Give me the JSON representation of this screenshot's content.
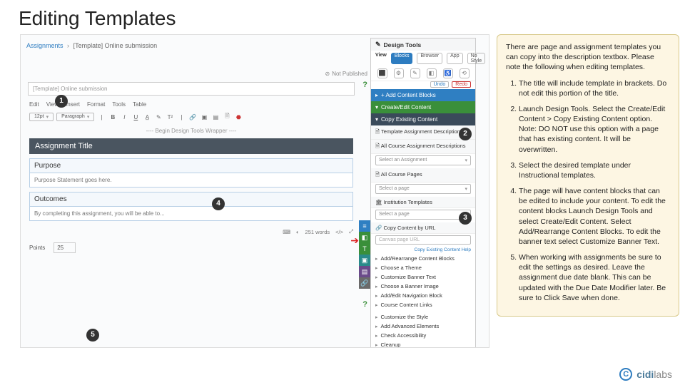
{
  "page_title": "Editing Templates",
  "breadcrumb": {
    "root": "Assignments",
    "current": "[Template] Online submission"
  },
  "not_published": "Not Published",
  "design_tools": {
    "header": "Design Tools",
    "view_label": "View",
    "view_opts": [
      "Blocks",
      "Browser",
      "App",
      "No Style"
    ],
    "add_blocks": "+ Add Content Blocks",
    "undo": "Undo",
    "redo": "Redo",
    "create_edit": "Create/Edit Content",
    "copy_existing": "Copy Existing Content",
    "template_desc": "Template Assignment Descriptions",
    "all_course_desc": "All Course Assignment Descriptions",
    "select_assignment": "Select an Assignment",
    "all_course_pages": "All Course Pages",
    "select_page": "Select a page",
    "institution_templates": "Institution Templates",
    "select_page2": "Select a page",
    "copy_by_url": "Copy Content by URL",
    "url_placeholder": "Canvas page URL",
    "help_link": "Copy Existing Content Help",
    "items": [
      "Add/Rearrange Content Blocks",
      "Choose a Theme",
      "Customize Banner Text",
      "Choose a Banner Image",
      "Add/Edit Navigation Block",
      "Course Content Links"
    ],
    "style_items": [
      "Customize the Style",
      "Add Advanced Elements",
      "Check Accessibility",
      "Cleanup"
    ]
  },
  "editor": {
    "title_field": "[Template] Online submission",
    "tabs": [
      "Edit",
      "View",
      "Insert",
      "Format",
      "Tools",
      "Table"
    ],
    "fontsize": "12pt",
    "para": "Paragraph",
    "wrapper": "---- Begin Design Tools Wrapper ----",
    "assign_title": "Assignment Title",
    "purpose_head": "Purpose",
    "purpose_body": "Purpose Statement goes here.",
    "outcomes_head": "Outcomes",
    "outcomes_body": "By completing this assignment, you will be able to...",
    "wordcount": "251 words",
    "code": "</>",
    "points_label": "Points",
    "points_value": "25"
  },
  "callouts": {
    "1": "1",
    "2": "2",
    "3": "3",
    "4": "4",
    "5": "5"
  },
  "instructions": {
    "intro": "There are page and assignment templates you can copy into the description textbox. Please note the following when editing templates.",
    "items": [
      "The title will include template in brackets. Do not edit this portion of the title.",
      "Launch Design Tools. Select the Create/Edit Content > Copy Existing Content option. Note: DO NOT use this option with a page that has existing content. It will be overwritten.",
      "Select the desired template under Instructional templates.",
      "The page will have content blocks that can be edited to include your content. To edit the content blocks Launch Design Tools and select Create/Edit Content. Select Add/Rearrange Content Blocks. To edit the banner text select Customize Banner Text.",
      "When working with assignments be sure to edit the settings as desired. Leave the assignment due date blank. This can be updated with the Due Date Modifier later. Be sure to Click Save when done."
    ]
  },
  "brand": {
    "name": "cidi",
    "suffix": "labs"
  }
}
